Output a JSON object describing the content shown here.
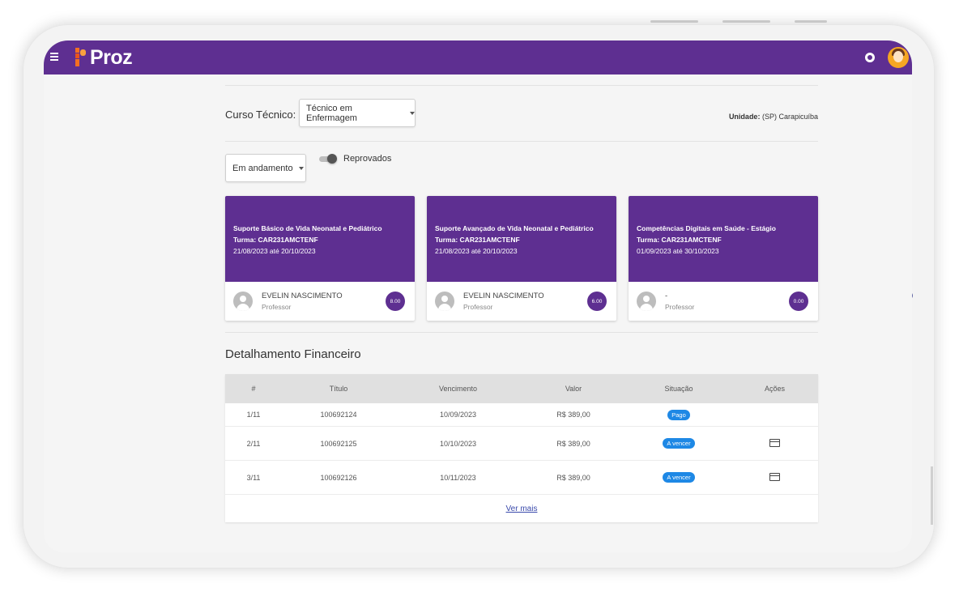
{
  "app": {
    "brand": "Proz"
  },
  "filters": {
    "course_label": "Curso Técnico:",
    "course_value": "Técnico em Enfermagem",
    "unit_label": "Unidade:",
    "unit_value": "(SP) Carapicuíba",
    "status_value": "Em andamento",
    "toggle_label": "Reprovados",
    "toggle_on": false
  },
  "cards": [
    {
      "title": "Suporte Básico de Vida Neonatal e Pediátrico",
      "class": "Turma: CAR231AMCTENF",
      "dates": "21/08/2023 até 20/10/2023",
      "teacher": "EVELIN NASCIMENTO",
      "role": "Professor",
      "grade": "8.00"
    },
    {
      "title": "Suporte Avançado de Vida Neonatal e Pediátrico",
      "class": "Turma: CAR231AMCTENF",
      "dates": "21/08/2023 até 20/10/2023",
      "teacher": "EVELIN NASCIMENTO",
      "role": "Professor",
      "grade": "6.00"
    },
    {
      "title": "Competências Digitais em Saúde - Estágio",
      "class": "Turma: CAR231AMCTENF",
      "dates": "01/09/2023 até 30/10/2023",
      "teacher": "-",
      "role": "Professor",
      "grade": "0.00"
    }
  ],
  "finance": {
    "title": "Detalhamento Financeiro",
    "headers": [
      "#",
      "Título",
      "Vencimento",
      "Valor",
      "Situação",
      "Ações"
    ],
    "rows": [
      {
        "num": "1/11",
        "title": "100692124",
        "due": "10/09/2023",
        "value": "R$ 389,00",
        "status": "Pago",
        "action": false
      },
      {
        "num": "2/11",
        "title": "100692125",
        "due": "10/10/2023",
        "value": "R$ 389,00",
        "status": "A vencer",
        "action": true
      },
      {
        "num": "3/11",
        "title": "100692126",
        "due": "10/11/2023",
        "value": "R$ 389,00",
        "status": "A vencer",
        "action": true
      }
    ],
    "see_more": "Ver mais"
  },
  "colors": {
    "brand_purple": "#5e2f91",
    "status_blue": "#1e88e5",
    "logo_orange": "#f36f21"
  },
  "icons": {
    "menu": "menu-icon",
    "notification": "ring-icon",
    "user": "avatar",
    "pay": "credit-card-icon"
  }
}
